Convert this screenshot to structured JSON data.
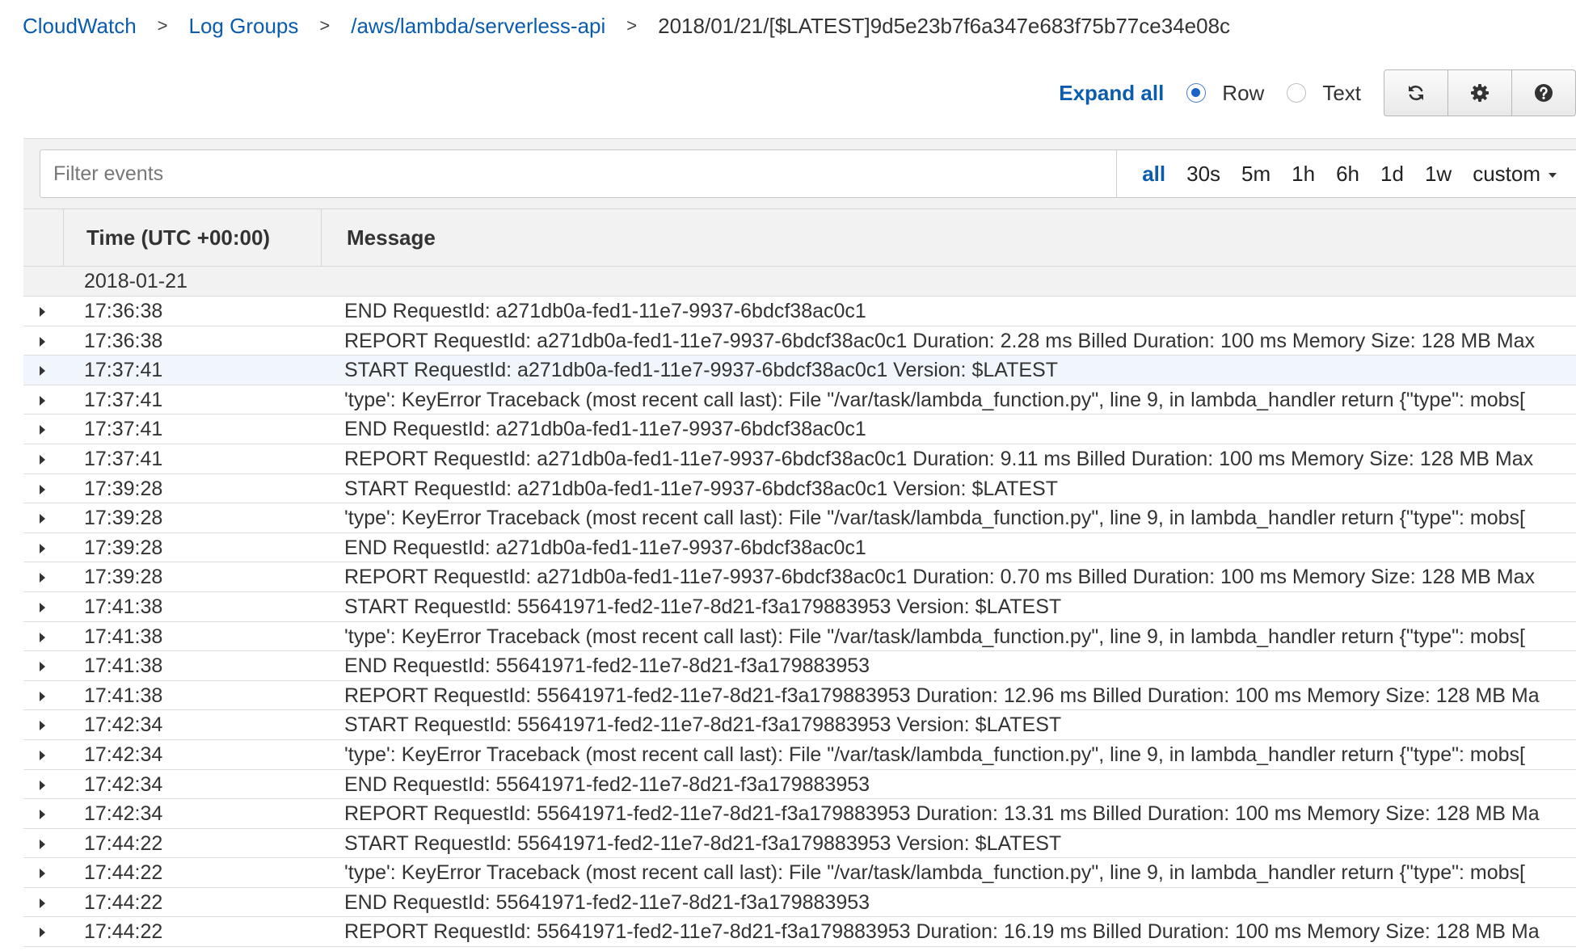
{
  "breadcrumb": {
    "items": [
      "CloudWatch",
      "Log Groups",
      "/aws/lambda/serverless-api"
    ],
    "current": "2018/01/21/[$LATEST]9d5e23b7f6a347e683f75b77ce34e08c",
    "separator": ">"
  },
  "toolbar": {
    "expand_all": "Expand all",
    "view_mode": "Row",
    "radio_row": "Row",
    "radio_text": "Text",
    "buttons": [
      "refresh-icon",
      "gear-icon",
      "help-icon"
    ]
  },
  "filter": {
    "placeholder": "Filter events",
    "value": "",
    "ranges": [
      "all",
      "30s",
      "5m",
      "1h",
      "6h",
      "1d",
      "1w"
    ],
    "active_range": "all",
    "custom": "custom"
  },
  "table": {
    "col_time": "Time (UTC +00:00)",
    "col_message": "Message",
    "date": "2018-01-21",
    "rows": [
      {
        "time": "17:36:38",
        "message": "END RequestId: a271db0a-fed1-11e7-9937-6bdcf38ac0c1"
      },
      {
        "time": "17:36:38",
        "message": "REPORT RequestId: a271db0a-fed1-11e7-9937-6bdcf38ac0c1 Duration: 2.28 ms Billed Duration: 100 ms Memory Size: 128 MB Max"
      },
      {
        "time": "17:37:41",
        "message": "START RequestId: a271db0a-fed1-11e7-9937-6bdcf38ac0c1 Version: $LATEST"
      },
      {
        "time": "17:37:41",
        "message": "'type': KeyError Traceback (most recent call last): File \"/var/task/lambda_function.py\", line 9, in lambda_handler return {\"type\": mobs["
      },
      {
        "time": "17:37:41",
        "message": "END RequestId: a271db0a-fed1-11e7-9937-6bdcf38ac0c1"
      },
      {
        "time": "17:37:41",
        "message": "REPORT RequestId: a271db0a-fed1-11e7-9937-6bdcf38ac0c1 Duration: 9.11 ms Billed Duration: 100 ms Memory Size: 128 MB Max"
      },
      {
        "time": "17:39:28",
        "message": "START RequestId: a271db0a-fed1-11e7-9937-6bdcf38ac0c1 Version: $LATEST"
      },
      {
        "time": "17:39:28",
        "message": "'type': KeyError Traceback (most recent call last): File \"/var/task/lambda_function.py\", line 9, in lambda_handler return {\"type\": mobs["
      },
      {
        "time": "17:39:28",
        "message": "END RequestId: a271db0a-fed1-11e7-9937-6bdcf38ac0c1"
      },
      {
        "time": "17:39:28",
        "message": "REPORT RequestId: a271db0a-fed1-11e7-9937-6bdcf38ac0c1 Duration: 0.70 ms Billed Duration: 100 ms Memory Size: 128 MB Max"
      },
      {
        "time": "17:41:38",
        "message": "START RequestId: 55641971-fed2-11e7-8d21-f3a179883953 Version: $LATEST"
      },
      {
        "time": "17:41:38",
        "message": "'type': KeyError Traceback (most recent call last): File \"/var/task/lambda_function.py\", line 9, in lambda_handler return {\"type\": mobs["
      },
      {
        "time": "17:41:38",
        "message": "END RequestId: 55641971-fed2-11e7-8d21-f3a179883953"
      },
      {
        "time": "17:41:38",
        "message": "REPORT RequestId: 55641971-fed2-11e7-8d21-f3a179883953 Duration: 12.96 ms Billed Duration: 100 ms Memory Size: 128 MB Ma"
      },
      {
        "time": "17:42:34",
        "message": "START RequestId: 55641971-fed2-11e7-8d21-f3a179883953 Version: $LATEST"
      },
      {
        "time": "17:42:34",
        "message": "'type': KeyError Traceback (most recent call last): File \"/var/task/lambda_function.py\", line 9, in lambda_handler return {\"type\": mobs["
      },
      {
        "time": "17:42:34",
        "message": "END RequestId: 55641971-fed2-11e7-8d21-f3a179883953"
      },
      {
        "time": "17:42:34",
        "message": "REPORT RequestId: 55641971-fed2-11e7-8d21-f3a179883953 Duration: 13.31 ms Billed Duration: 100 ms Memory Size: 128 MB Ma"
      },
      {
        "time": "17:44:22",
        "message": "START RequestId: 55641971-fed2-11e7-8d21-f3a179883953 Version: $LATEST"
      },
      {
        "time": "17:44:22",
        "message": "'type': KeyError Traceback (most recent call last): File \"/var/task/lambda_function.py\", line 9, in lambda_handler return {\"type\": mobs["
      },
      {
        "time": "17:44:22",
        "message": "END RequestId: 55641971-fed2-11e7-8d21-f3a179883953"
      },
      {
        "time": "17:44:22",
        "message": "REPORT RequestId: 55641971-fed2-11e7-8d21-f3a179883953 Duration: 16.19 ms Billed Duration: 100 ms Memory Size: 128 MB Ma"
      }
    ]
  },
  "colors": {
    "link": "#0a5cae",
    "radio_selected": "#1a64c8",
    "panel_bg": "#f2f2f2",
    "row_highlight": "#f1f6fd"
  }
}
